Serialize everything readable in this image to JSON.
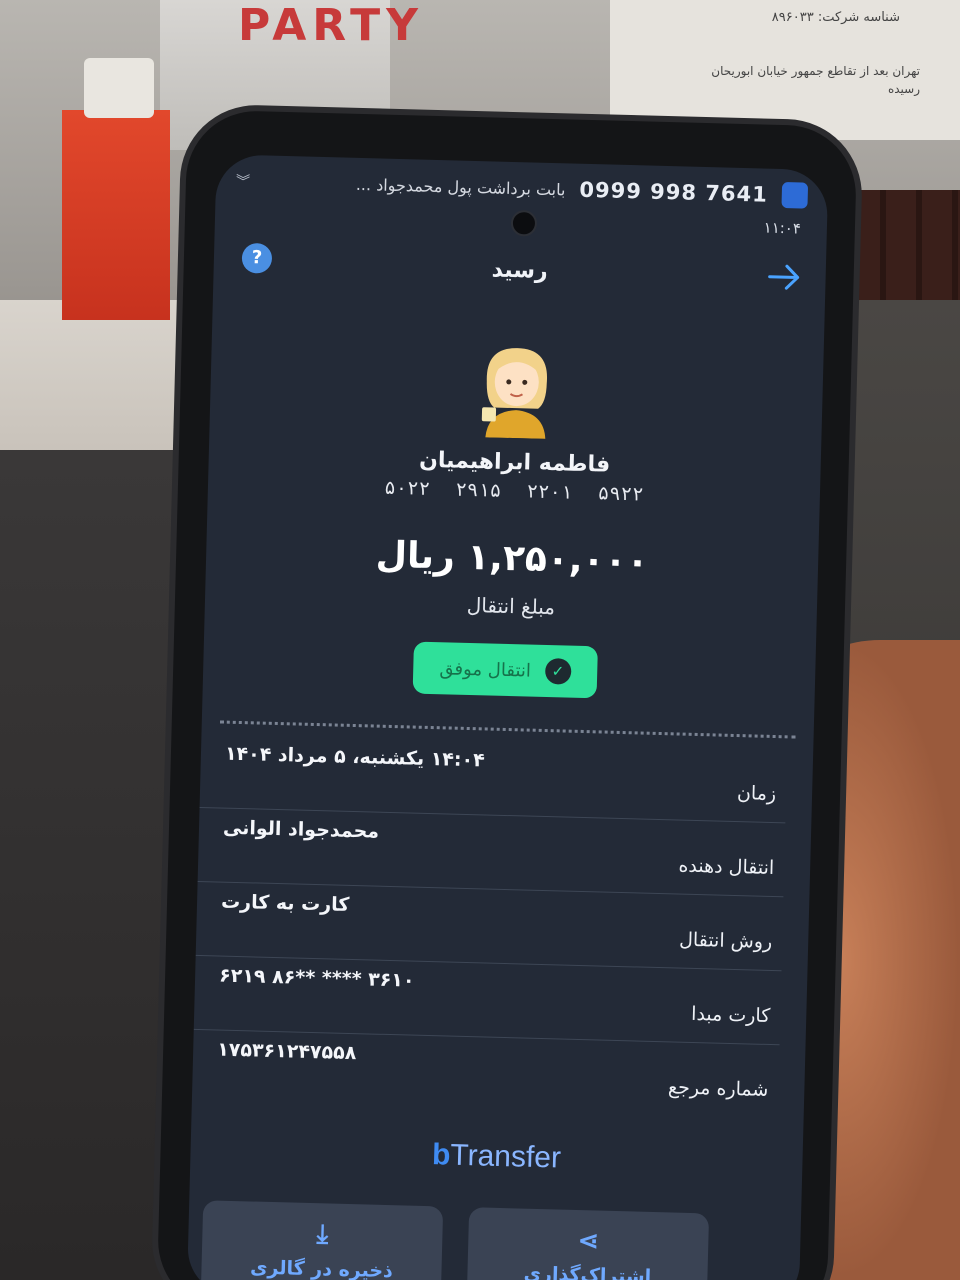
{
  "background": {
    "box_text": "PARTY",
    "paper_line1": "شناسه شرکت: ۸۹۶۰۳۳",
    "paper_line2": "تهران بعد از تقاطع جمهور خیابان ابوریحان رسیده"
  },
  "statusbar": {
    "notification": "بابت برداشت پول محمدجواد ...",
    "phone_number": "0999 998 7641",
    "time": "۱۱:۰۴"
  },
  "header": {
    "title": "رسید",
    "help_icon": "question-icon",
    "back_icon": "arrow-right-icon"
  },
  "recipient": {
    "name": "فاطمه ابراهیمیان",
    "card_number": "۵۰۲۲ ۲۹۱۵ ۲۲۰۱ ۵۹۲۲"
  },
  "amount": {
    "value": "۱,۲۵۰,۰۰۰ ریال",
    "label": "مبلغ انتقال"
  },
  "status": {
    "text": "انتقال موفق",
    "color": "#2fe09a"
  },
  "details": [
    {
      "label": "زمان",
      "value": "۱۴:۰۴ یکشنبه، ۵ مرداد ۱۴۰۴"
    },
    {
      "label": "انتقال دهنده",
      "value": "محمدجواد الوانی"
    },
    {
      "label": "روش انتقال",
      "value": "کارت به کارت"
    },
    {
      "label": "کارت مبدا",
      "value": "۶۲۱۹ ۸۶** **** ۳۶۱۰"
    },
    {
      "label": "شماره مرجع",
      "value": "۱۷۵۳۶۱۲۴۷۵۵۸"
    }
  ],
  "brand": {
    "logo_b": "b",
    "logo_rest": "Transfer"
  },
  "actions": {
    "save": "ذخیره در گالری",
    "share": "اشتراک‌گذاری"
  }
}
